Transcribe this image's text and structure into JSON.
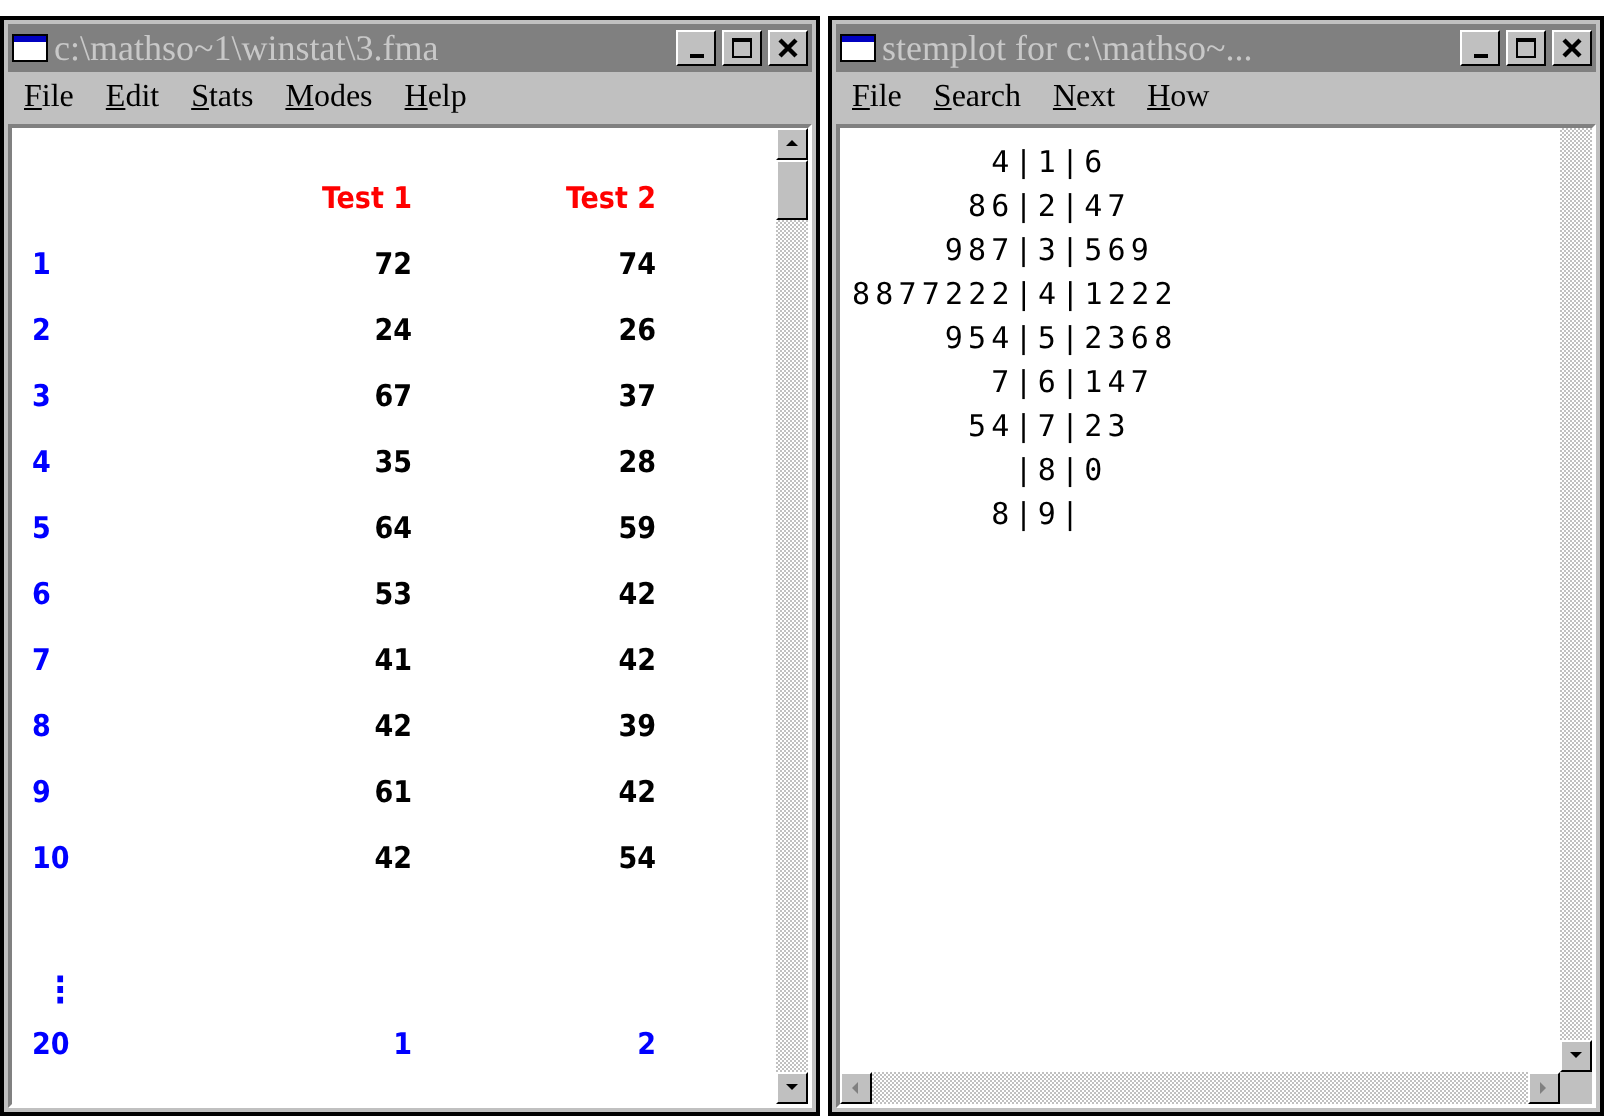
{
  "windows": [
    {
      "title": "c:\\mathso~1\\winstat\\3.fma",
      "active": false,
      "menus": [
        "File",
        "Edit",
        "Stats",
        "Modes",
        "Help"
      ],
      "kind": "data",
      "columns": [
        "Test 1",
        "Test 2"
      ],
      "rows": [
        {
          "index": "1",
          "values": [
            "72",
            "74"
          ],
          "kind": "plain"
        },
        {
          "index": "2",
          "values": [
            "24",
            "26"
          ],
          "kind": "plain"
        },
        {
          "index": "3",
          "values": [
            "67",
            "37"
          ],
          "kind": "plain"
        },
        {
          "index": "4",
          "values": [
            "35",
            "28"
          ],
          "kind": "plain"
        },
        {
          "index": "5",
          "values": [
            "64",
            "59"
          ],
          "kind": "plain"
        },
        {
          "index": "6",
          "values": [
            "53",
            "42"
          ],
          "kind": "plain"
        },
        {
          "index": "7",
          "values": [
            "41",
            "42"
          ],
          "kind": "plain"
        },
        {
          "index": "8",
          "values": [
            "42",
            "39"
          ],
          "kind": "plain"
        },
        {
          "index": "9",
          "values": [
            "61",
            "42"
          ],
          "kind": "plain"
        },
        {
          "index": "10",
          "values": [
            "42",
            "54"
          ],
          "kind": "plain"
        },
        {
          "index": "⋮",
          "kind": "gap"
        },
        {
          "index": "20",
          "values": [
            "1",
            "2"
          ],
          "kind": "highlight"
        }
      ]
    },
    {
      "title": "stemplot for c:\\mathso~...",
      "active": false,
      "menus": [
        "File",
        "Search",
        "Next",
        "How"
      ],
      "kind": "stemplot",
      "lines": [
        "4|1|6",
        "86|2|47",
        "987|3|569",
        "8877222|4|1222",
        "954|5|2368",
        "7|6|147",
        "54|7|23",
        "|8|0",
        "8|9|"
      ]
    }
  ]
}
